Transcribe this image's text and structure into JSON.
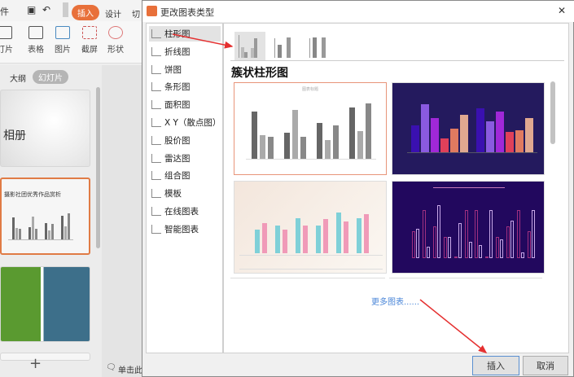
{
  "app": {
    "menu": {
      "file_partial": "件",
      "insert": "插入",
      "design": "设计",
      "switch_partial": "切"
    },
    "ribbon": [
      {
        "label": "灯片"
      },
      {
        "label": "表格"
      },
      {
        "label": "图片"
      },
      {
        "label": "截屏"
      },
      {
        "label": "形状"
      }
    ],
    "tabs": {
      "outline": "大纲",
      "slides": "幻灯片"
    },
    "slides": [
      {
        "title": "相册"
      },
      {
        "title": "摄影社团优秀作品赏析"
      }
    ],
    "add_slide": "+",
    "notes_hint": "单击此"
  },
  "dialog": {
    "title": "更改图表类型",
    "close": "✕",
    "categories": [
      "柱形图",
      "折线图",
      "饼图",
      "条形图",
      "面积图",
      "X Y（散点图）",
      "股价图",
      "雷达图",
      "组合图",
      "模板",
      "在线图表",
      "智能图表"
    ],
    "selected_category": 0,
    "subtype_heading": "簇状柱形图",
    "thumbnail_title": "图表标题",
    "thumb1_values": [
      [
        6,
        3,
        2.8
      ],
      [
        3.3,
        6.2,
        2.8
      ],
      [
        4.5,
        2.4,
        4.2
      ],
      [
        6.5,
        3.5,
        7
      ]
    ],
    "thumb2_values": [
      [
        4,
        7,
        5,
        2,
        3.5,
        5.5
      ],
      [
        6.5,
        4.5,
        6,
        3,
        3.2,
        5
      ]
    ],
    "thumb3_values": [
      [
        3,
        3.8
      ],
      [
        3.5,
        3
      ],
      [
        4.5,
        3.5
      ],
      [
        3.5,
        4.3
      ],
      [
        5.2,
        4
      ],
      [
        4.5,
        5
      ]
    ],
    "thumb4_values": [
      [
        5,
        5.5
      ],
      [
        9,
        2.2
      ],
      [
        6,
        10
      ],
      [
        4,
        4
      ],
      [
        0,
        6.5
      ],
      [
        9,
        3
      ],
      [
        9,
        2.5
      ],
      [
        0,
        9
      ],
      [
        4,
        3.5
      ],
      [
        6,
        7
      ],
      [
        9,
        1
      ],
      [
        5,
        9
      ]
    ],
    "more_charts": "更多图表......",
    "insert_button": "插入",
    "cancel_button": "取消"
  }
}
